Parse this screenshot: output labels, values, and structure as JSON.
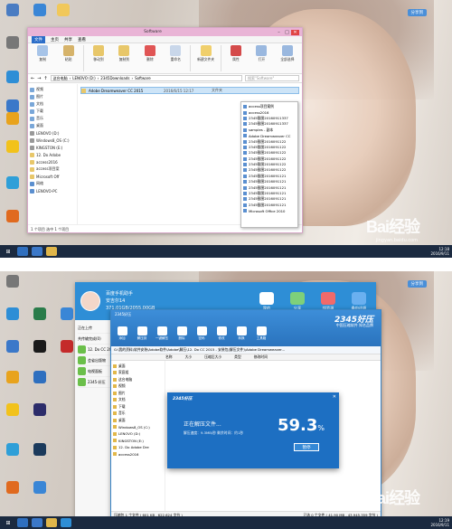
{
  "shot1": {
    "share_button": "分享到",
    "explorer": {
      "title": "Software",
      "ribbon_tabs": [
        "文件",
        "主页",
        "共享",
        "查看"
      ],
      "ribbon_groups": [
        {
          "label": "复制"
        },
        {
          "label": "粘贴"
        },
        {
          "label": "移动到"
        },
        {
          "label": "复制到"
        },
        {
          "label": "删除"
        },
        {
          "label": "重命名"
        },
        {
          "label": "新建文件夹"
        },
        {
          "label": "属性"
        },
        {
          "label": "打开"
        },
        {
          "label": "全部选择"
        }
      ],
      "address_parts": [
        "这台电脑",
        "LENOVO (D:)",
        "2345Downloads",
        "Software"
      ],
      "search_placeholder": "搜索\"Software\"",
      "nav_items": [
        "视频",
        "图片",
        "文档",
        "下载",
        "音乐",
        "桌面",
        "LENOVO (D:)",
        "Windows8_OS (C:)",
        "KINGSTON (E:)",
        "12. Do Adobe",
        "access2016",
        "access项目案",
        "Microsoft Off",
        "网络",
        "LENOVO-PC"
      ],
      "files": [
        {
          "name": "Adobe Dreamweaver CC 2015",
          "date": "2016/6/15 12:17",
          "type": "文件夹"
        }
      ],
      "status": "1 个项目   选中 1 个项目"
    },
    "popup_items": [
      "access项目案例",
      "access2016",
      "2345截图20160911337",
      "2345截图20160911337",
      "samples - 副本",
      "Adobe Dreamweaver CC",
      "2345截图2016091122",
      "2345截图2016091122",
      "2345截图2016091122",
      "2345截图2016091122",
      "2345截图2016091122",
      "2345截图2016091122",
      "2345截图2016091121",
      "2345截图2016091121",
      "2345截图2016091121",
      "2345截图2016091121",
      "2345截图2016091121",
      "2345截图2016091121",
      "Microsoft Office 2010"
    ],
    "watermark": "Bai经验",
    "watermark_url": "jingyan.baidu.com",
    "tray_time": "12:18",
    "tray_date": "2016/9/11"
  },
  "shot2": {
    "share_button": "分享到",
    "assistant": {
      "title": "百度手机助手",
      "username": "安吉尔14",
      "user_sub": "371.01GB/2055.00GB",
      "tabs": [
        "我的",
        "分享",
        "找资源",
        "备份还原"
      ],
      "left_items": [
        "正在上传",
        "共传输完成(0)",
        "12. Do CC 2015",
        "会省出版物",
        "电视面板",
        "2345-好压"
      ]
    },
    "zip": {
      "title": "2345好压",
      "brand": "2345好压",
      "slogan": "中国压缩软件 知名品牌",
      "tools": [
        "添加",
        "解压到",
        "一键解压",
        "删除",
        "密码",
        "修改",
        "转换",
        "工具箱"
      ],
      "address": "G:\\我的资料\\软件安装\\Adobe软件\\Adobe\\解压\\12. Do CC 2015 - 安装包(解压文件)\\Adobe Dreamweaver...",
      "columns": [
        "名称",
        "大小",
        "压缩后大小",
        "类型",
        "修改时间"
      ],
      "tree": [
        "桌面",
        "家庭组",
        "这台电脑",
        "视频",
        "图片",
        "文档",
        "下载",
        "音乐",
        "桌面",
        "Windows8_OS (C:)",
        "LENOVO (D:)",
        "KINGSTON (E:)",
        "12. Do Adobe Dre",
        "access2016"
      ],
      "status_left": "压缩包 1 个文件 ( 601 KB , 622,624 字节 )",
      "status_right": "已选 0 个文件 ( 41.90 MB , 43,945,359 字节 )"
    },
    "progress": {
      "brand": "2345好压",
      "status": "正在解压文件...",
      "detail": "解压速度：9.3MB/秒   剩余时间：约1秒",
      "percent": "59.3",
      "percent_sign": "%",
      "pause": "暂停",
      "value": 0.593
    },
    "watermark": "Bai经验",
    "tray_time": "12:19",
    "tray_date": "2016/9/11"
  },
  "colors": {
    "explorer_title": "#e9b4d6",
    "assistant_blue": "#2e8ed6",
    "progress_blue": "#1d6fc2",
    "taskbar": "#1b2a40"
  }
}
